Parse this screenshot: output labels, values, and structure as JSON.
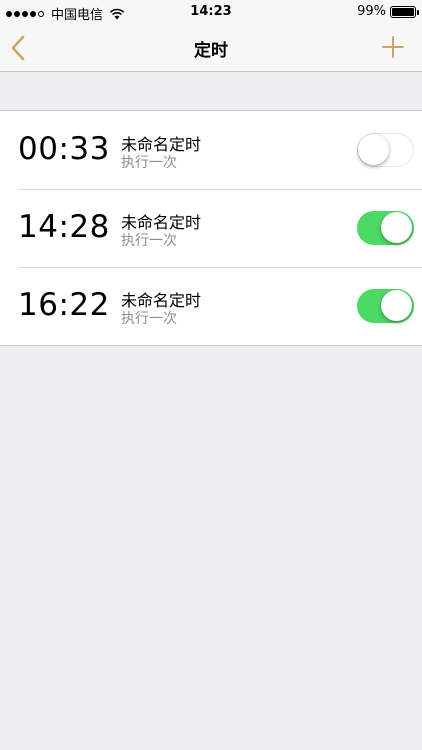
{
  "status_bar": {
    "carrier": "中国电信",
    "signal_dots_filled": 4,
    "signal_dots_total": 5,
    "time": "14:23",
    "battery": "99%",
    "battery_level": 0.99
  },
  "nav": {
    "title": "定时",
    "back_icon": "chevron-left-icon",
    "add_icon": "plus-icon",
    "accent_color": "#c9a46c"
  },
  "timers": [
    {
      "time": "00:33",
      "name": "未命名定时",
      "repeat": "执行一次",
      "enabled": false
    },
    {
      "time": "14:28",
      "name": "未命名定时",
      "repeat": "执行一次",
      "enabled": true
    },
    {
      "time": "16:22",
      "name": "未命名定时",
      "repeat": "执行一次",
      "enabled": true
    }
  ],
  "colors": {
    "toggle_on": "#4cd964",
    "background": "#efeff4"
  }
}
